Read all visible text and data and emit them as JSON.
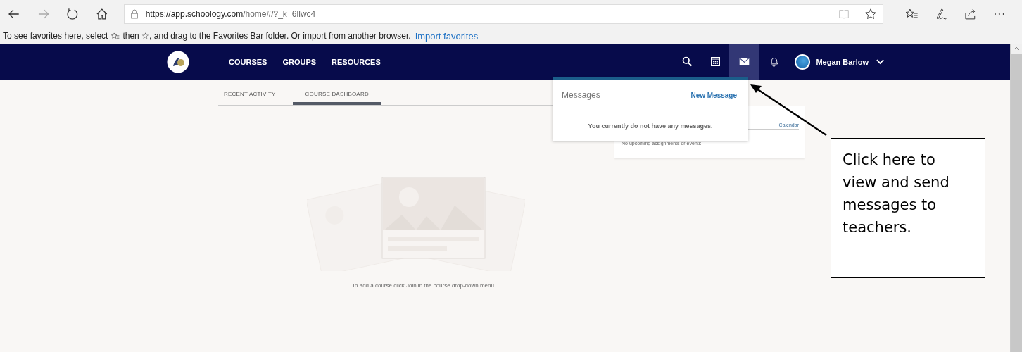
{
  "browser": {
    "url_host": "https://app.schoology.com",
    "url_path": "/home#/?_k=6llwc4"
  },
  "favorites_bar": {
    "text_1": "To see favorites here, select",
    "text_2": "then ☆, and drag to the Favorites Bar folder. Or import from another browser.",
    "link": "Import favorites"
  },
  "nav": {
    "items": [
      "COURSES",
      "GROUPS",
      "RESOURCES"
    ],
    "icons": [
      {
        "kind": "search",
        "selected": false
      },
      {
        "kind": "calendar",
        "selected": false
      },
      {
        "kind": "mail",
        "selected": true
      },
      {
        "kind": "bell",
        "selected": false
      }
    ],
    "user_name": "Megan Barlow"
  },
  "tabs": [
    {
      "label": "RECENT ACTIVITY",
      "selected": false
    },
    {
      "label": "COURSE DASHBOARD",
      "selected": true
    }
  ],
  "empty_state": "To add a course click Join in the course drop-down menu",
  "upcoming": {
    "link": "Calendar",
    "text": "No upcoming assignments or events"
  },
  "messages_dropdown": {
    "title": "Messages",
    "action": "New Message",
    "empty": "You currently do not have any messages."
  },
  "annotation": "Click here to view and send messages to teachers."
}
